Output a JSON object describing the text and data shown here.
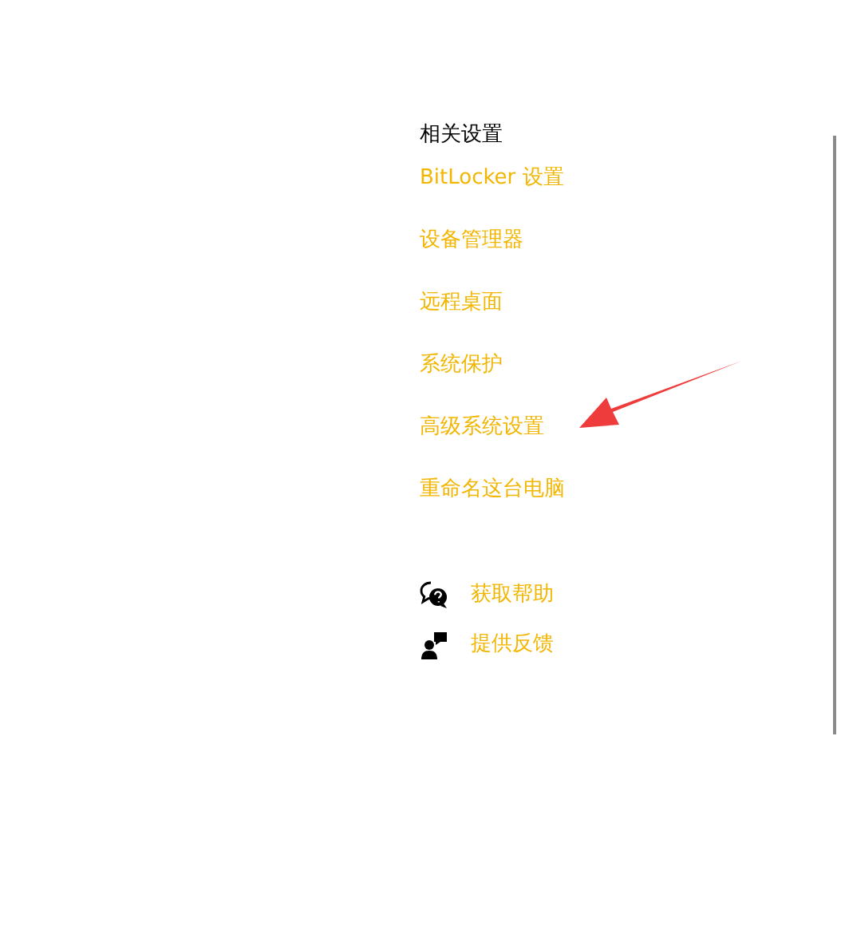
{
  "related_settings": {
    "heading": "相关设置",
    "links": [
      {
        "label": "BitLocker 设置"
      },
      {
        "label": "设备管理器"
      },
      {
        "label": "远程桌面"
      },
      {
        "label": "系统保护"
      },
      {
        "label": "高级系统设置"
      },
      {
        "label": "重命名这台电脑"
      }
    ]
  },
  "support": [
    {
      "kind": "help",
      "label": "获取帮助"
    },
    {
      "kind": "feedback",
      "label": "提供反馈"
    }
  ]
}
